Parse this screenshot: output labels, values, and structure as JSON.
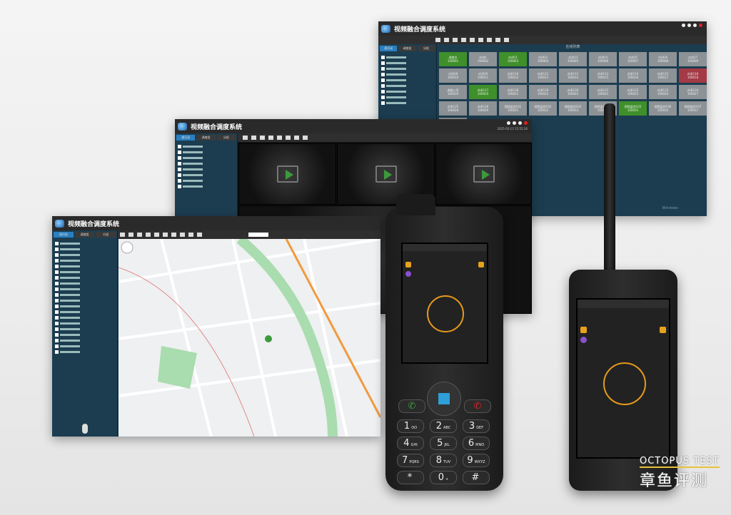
{
  "app_title": "视频融合调度系统",
  "window_tabs": [
    "通讯录",
    "调度组",
    "分组"
  ],
  "grid_header": "在线列表",
  "grid_tiles": [
    {
      "label": "调度台",
      "id": "100001",
      "state": "online"
    },
    {
      "label": "对讲1",
      "id": "100002",
      "state": "offline"
    },
    {
      "label": "对讲11",
      "id": "100003",
      "state": "online"
    },
    {
      "label": "对讲12",
      "id": "100004",
      "state": "offline"
    },
    {
      "label": "对讲13",
      "id": "100005",
      "state": "offline"
    },
    {
      "label": "对讲14",
      "id": "100006",
      "state": "offline"
    },
    {
      "label": "对讲15",
      "id": "100007",
      "state": "offline"
    },
    {
      "label": "对讲16",
      "id": "100008",
      "state": "offline"
    },
    {
      "label": "对讲17",
      "id": "100009",
      "state": "offline"
    },
    {
      "label": "对讲18",
      "id": "100010",
      "state": "offline"
    },
    {
      "label": "对讲19",
      "id": "100011",
      "state": "offline"
    },
    {
      "label": "对讲110",
      "id": "100012",
      "state": "offline"
    },
    {
      "label": "对讲111",
      "id": "100013",
      "state": "offline"
    },
    {
      "label": "对讲112",
      "id": "100014",
      "state": "offline"
    },
    {
      "label": "对讲113",
      "id": "100015",
      "state": "offline"
    },
    {
      "label": "对讲114",
      "id": "100016",
      "state": "offline"
    },
    {
      "label": "对讲115",
      "id": "100017",
      "state": "offline"
    },
    {
      "label": "对讲116",
      "id": "100018",
      "state": "alarm"
    },
    {
      "label": "调度公司",
      "id": "100019",
      "state": "offline"
    },
    {
      "label": "对讲117",
      "id": "100020",
      "state": "online"
    },
    {
      "label": "对讲118",
      "id": "100021",
      "state": "offline"
    },
    {
      "label": "对讲119",
      "id": "100022",
      "state": "offline"
    },
    {
      "label": "对讲120",
      "id": "100023",
      "state": "offline"
    },
    {
      "label": "对讲121",
      "id": "100024",
      "state": "offline"
    },
    {
      "label": "对讲122",
      "id": "100025",
      "state": "offline"
    },
    {
      "label": "对讲123",
      "id": "100026",
      "state": "offline"
    },
    {
      "label": "对讲124",
      "id": "100027",
      "state": "offline"
    },
    {
      "label": "对讲125",
      "id": "100028",
      "state": "offline"
    },
    {
      "label": "对讲126",
      "id": "100029",
      "state": "offline"
    },
    {
      "label": "视频监控101",
      "id": "100031",
      "state": "offline"
    },
    {
      "label": "视频监控102",
      "id": "100032",
      "state": "offline"
    },
    {
      "label": "视频监控103",
      "id": "100033",
      "state": "offline"
    },
    {
      "label": "视频监控104",
      "id": "100034",
      "state": "offline"
    },
    {
      "label": "视频监控105",
      "id": "100035",
      "state": "online"
    },
    {
      "label": "视频监控106",
      "id": "100036",
      "state": "offline"
    },
    {
      "label": "视频监控107",
      "id": "100037",
      "state": "offline"
    },
    {
      "label": "调度公司",
      "id": "1000001",
      "state": "offline"
    }
  ],
  "status_text": "2025-03-13 15:55:26",
  "phone_keys": [
    {
      "num": "1",
      "sub": "OO"
    },
    {
      "num": "2",
      "sub": "ABC"
    },
    {
      "num": "3",
      "sub": "DEF"
    },
    {
      "num": "4",
      "sub": "GHI"
    },
    {
      "num": "5",
      "sub": "JKL"
    },
    {
      "num": "6",
      "sub": "MNO"
    },
    {
      "num": "7",
      "sub": "PQRS"
    },
    {
      "num": "8",
      "sub": "TUV"
    },
    {
      "num": "9",
      "sub": "WXYZ"
    },
    {
      "num": "*",
      "sub": ""
    },
    {
      "num": "0",
      "sub": "+"
    },
    {
      "num": "#",
      "sub": ""
    }
  ],
  "watermark": {
    "en": "OCTOPUS TEST",
    "cn": "章鱼评测"
  },
  "colors": {
    "online": "#3f8f2a",
    "offline": "#8d9296",
    "alarm": "#a33a45",
    "ptt_ring": "#e69a1c",
    "panel": "#1c3d50"
  }
}
